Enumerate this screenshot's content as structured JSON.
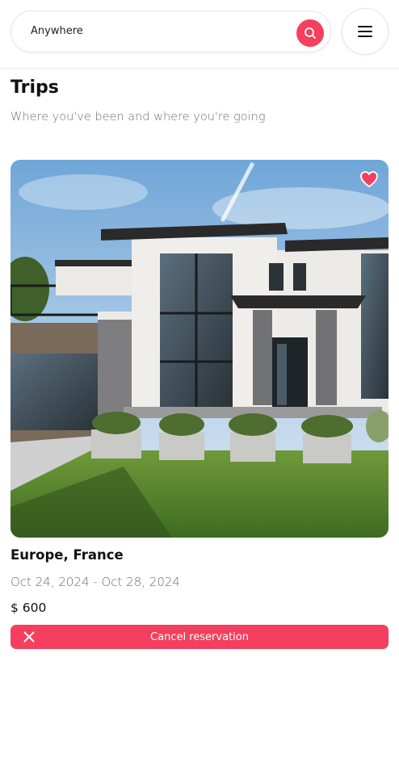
{
  "header": {
    "search": {
      "value": "Anywhere"
    }
  },
  "page": {
    "title": "Trips",
    "subtitle": "Where you've been and where you're going"
  },
  "trips": [
    {
      "image": "modern-house-photo",
      "favorited": true,
      "location": "Europe, France",
      "dates": "Oct 24, 2024 - Oct 28, 2024",
      "price": "$ 600",
      "action_label": "Cancel reservation"
    }
  ],
  "colors": {
    "accent": "#f43f5e",
    "text_primary": "#111111",
    "text_muted": "#737373"
  },
  "icons": {
    "search": "search-icon",
    "menu": "hamburger-menu-icon",
    "favorite": "heart-icon",
    "cancel": "close-icon"
  }
}
